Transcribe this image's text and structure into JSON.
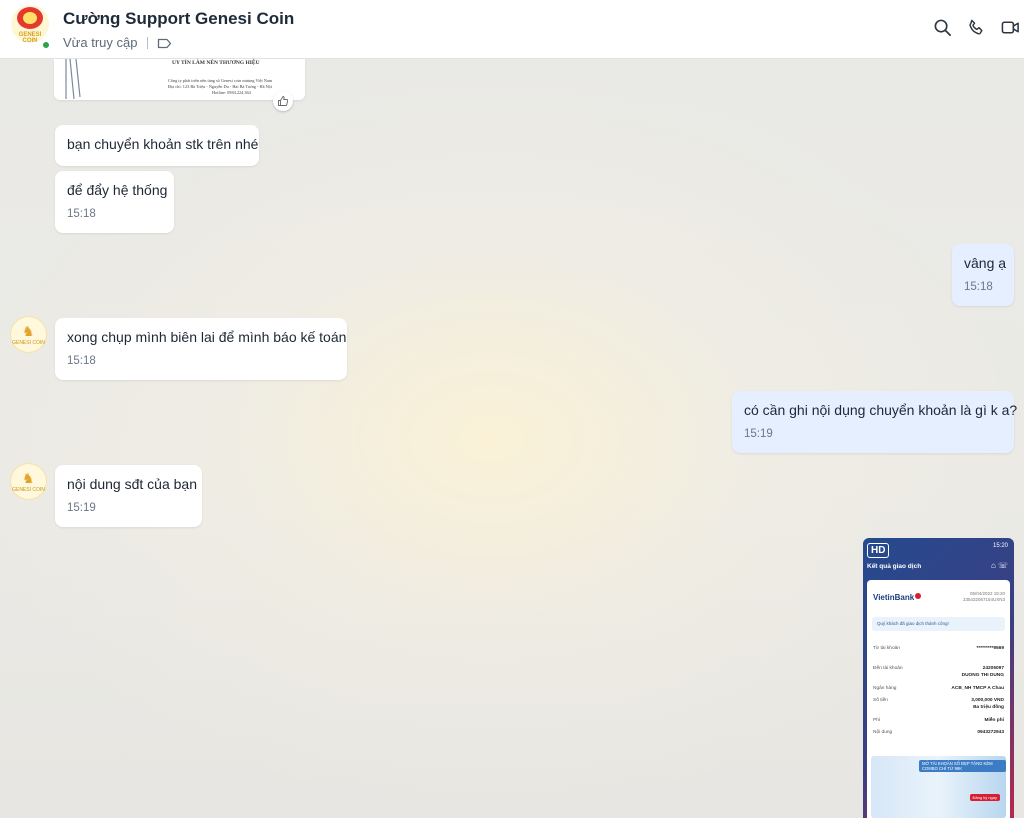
{
  "header": {
    "contact_name": "Cường Support Genesi Coin",
    "status": "Vừa truy cập",
    "avatar_text": "GENESI COIN"
  },
  "document_preview": {
    "title": "UY TÍN LÀM NÊN THƯƠNG HIỆU",
    "lines": [
      "Công ty phát triển nền tảng số Genesi coin mining Việt Nam",
      "Địa chỉ: 123 Bà Triệu - Nguyễn Du - Hai Bà Trưng - Hà Nội",
      "Hotline: 0984.224.364"
    ]
  },
  "messages": [
    {
      "side": "them",
      "text": "bạn chuyển khoản stk trên nhé",
      "time": ""
    },
    {
      "side": "them",
      "text": "để đẩy hệ thống",
      "time": "15:18"
    },
    {
      "side": "me",
      "text": "vâng ạ",
      "time": "15:18"
    },
    {
      "side": "them",
      "text": "xong chụp mình biên lai để mình báo kế toán",
      "time": "15:18"
    },
    {
      "side": "me",
      "text": "có cần ghi nội dụng chuyển khoản là gì k a?",
      "time": "15:19"
    },
    {
      "side": "them",
      "text": "nội dung sđt của bạn",
      "time": "15:19"
    }
  ],
  "receipt": {
    "badge": "HD",
    "status_time": "15:20",
    "title": "Kết quả giao dịch",
    "bank": "VietinBank",
    "datetime": "05/04/2022 15:20",
    "ref": "235432067154UXN3",
    "success": "Quý khách đã giao dịch thành công!",
    "rows": [
      {
        "label": "Từ tài khoản",
        "value": "*********9569",
        "sub": ""
      },
      {
        "label": "Đến tài khoản",
        "value": "24205097",
        "sub": "DUONG THI DUNG"
      },
      {
        "label": "Ngân hàng",
        "value": "ACB_NH TMCP A Chau",
        "sub": ""
      },
      {
        "label": "Số tiền",
        "value": "3,000,000 VND",
        "sub": "Ba triệu đồng"
      },
      {
        "label": "Phí",
        "value": "Miễn phí",
        "sub": ""
      },
      {
        "label": "Nội dung",
        "value": "0943272943",
        "sub": ""
      }
    ],
    "promo_text": "MỞ TÀI KHOẢN SỐ ĐẸP TẶNG KÈM COMBO CHỈ TỪ 99K",
    "promo_cta": "Đăng ký ngay"
  }
}
